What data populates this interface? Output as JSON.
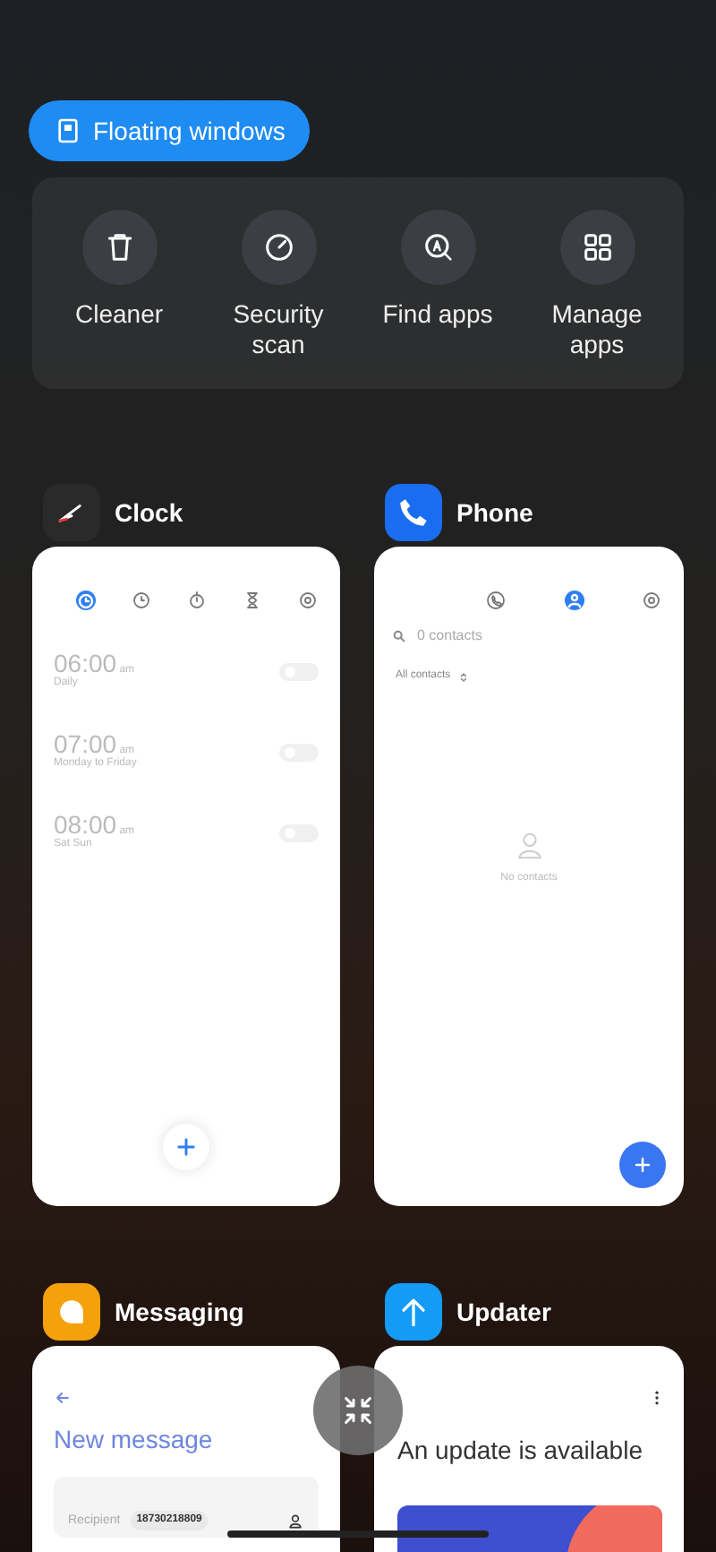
{
  "floating_button": {
    "label": "Floating windows"
  },
  "quick_actions": [
    {
      "kind": "trash",
      "label": "Cleaner"
    },
    {
      "kind": "gauge",
      "label": "Security scan"
    },
    {
      "kind": "find",
      "label": "Find apps"
    },
    {
      "kind": "grid",
      "label": "Manage apps"
    }
  ],
  "apps": [
    {
      "kind": "clock",
      "name": "Clock",
      "tabs": [
        {
          "kind": "alarm",
          "selected": true
        },
        {
          "kind": "clock",
          "selected": false
        },
        {
          "kind": "stopwatch",
          "selected": false
        },
        {
          "kind": "timer",
          "selected": false
        },
        {
          "kind": "settings",
          "selected": false
        }
      ],
      "alarms": [
        {
          "time": "06:00",
          "period": "am",
          "repeat": "Daily",
          "on": false
        },
        {
          "time": "07:00",
          "period": "am",
          "repeat": "Monday to Friday",
          "on": false
        },
        {
          "time": "08:00",
          "period": "am",
          "repeat": "Sat Sun",
          "on": false
        }
      ]
    },
    {
      "kind": "phone",
      "name": "Phone",
      "tabs": [
        {
          "kind": "calls",
          "selected": false
        },
        {
          "kind": "contacts",
          "selected": true
        },
        {
          "kind": "settings",
          "selected": false
        }
      ],
      "search": {
        "placeholder": "0 contacts"
      },
      "filter": "All contacts",
      "empty": "No contacts"
    },
    {
      "kind": "messaging",
      "name": "Messaging",
      "title": "New message",
      "recipient_label": "Recipient",
      "recipient": "18730218809"
    },
    {
      "kind": "updater",
      "name": "Updater",
      "title": "An update is available"
    }
  ]
}
